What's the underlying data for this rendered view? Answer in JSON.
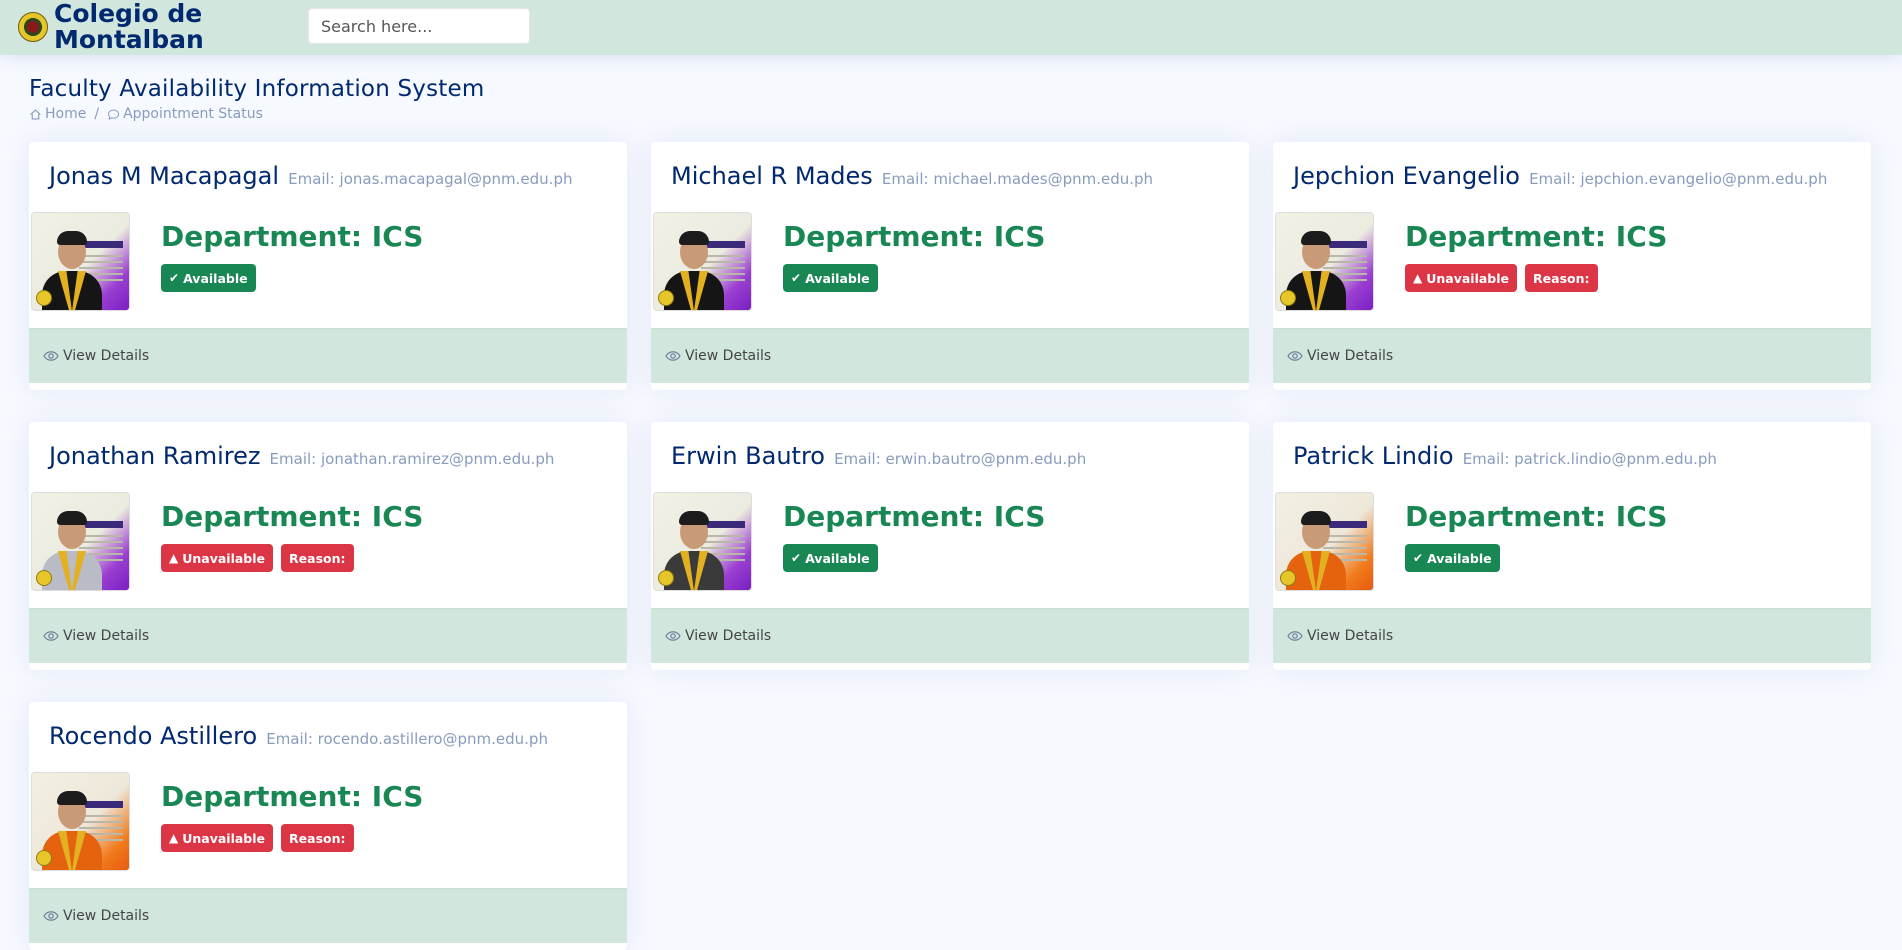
{
  "header": {
    "brand_line1": "Colegio de",
    "brand_line2": "Montalban",
    "search_placeholder": "Search here..."
  },
  "page": {
    "title": "Faculty Availability Information System",
    "breadcrumb": [
      "Home",
      "Appointment Status"
    ]
  },
  "labels": {
    "view_details": "View Details",
    "available": "Available",
    "unavailable": "Unavailable",
    "reason": "Reason:"
  },
  "faculty": [
    {
      "name": "Jonas M Macapagal",
      "email": "Email: jonas.macapagal@pnm.edu.ph",
      "department": "Department: ICS",
      "status": "available",
      "gown": "black"
    },
    {
      "name": "Michael R Mades",
      "email": "Email: michael.mades@pnm.edu.ph",
      "department": "Department: ICS",
      "status": "available",
      "gown": "black"
    },
    {
      "name": "Jepchion Evangelio",
      "email": "Email: jepchion.evangelio@pnm.edu.ph",
      "department": "Department: ICS",
      "status": "unavailable",
      "gown": "black"
    },
    {
      "name": "Jonathan Ramirez",
      "email": "Email: jonathan.ramirez@pnm.edu.ph",
      "department": "Department: ICS",
      "status": "unavailable",
      "gown": "silver"
    },
    {
      "name": "Erwin Bautro",
      "email": "Email: erwin.bautro@pnm.edu.ph",
      "department": "Department: ICS",
      "status": "available",
      "gown": "gray"
    },
    {
      "name": "Patrick Lindio",
      "email": "Email: patrick.lindio@pnm.edu.ph",
      "department": "Department: ICS",
      "status": "available",
      "gown": "orange"
    },
    {
      "name": "Rocendo Astillero",
      "email": "Email: rocendo.astillero@pnm.edu.ph",
      "department": "Department: ICS",
      "status": "unavailable",
      "gown": "orange"
    }
  ],
  "colors": {
    "header_bg": "#d1e7dd",
    "page_bg": "#f6f9ff",
    "title_text": "#012970",
    "department_green": "#198754",
    "available_badge": "#198754",
    "unavailable_badge": "#dc3545"
  }
}
